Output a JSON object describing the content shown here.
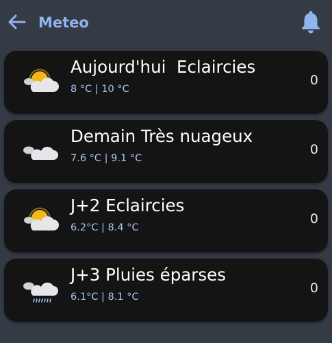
{
  "header": {
    "title": "Meteo",
    "back_icon": "arrow-left-icon",
    "bell_icon": "bell-icon",
    "accent_color": "#8fb4ee"
  },
  "forecast": [
    {
      "title": "Aujourd'hui  Eclaircies",
      "temps": "8 °C | 10 °C",
      "count": "0",
      "icon": "sun-cloud-icon"
    },
    {
      "title": "Demain Très nuageux",
      "temps": "7.6 °C | 9.1 °C",
      "count": "0",
      "icon": "clouds-icon"
    },
    {
      "title": "J+2 Eclaircies",
      "temps": "6.2°C | 8.4 °C",
      "count": "0",
      "icon": "sun-cloud-icon"
    },
    {
      "title": "J+3 Pluies éparses",
      "temps": "6.1°C | 8.1 °C",
      "count": "0",
      "icon": "rain-cloud-icon"
    }
  ]
}
